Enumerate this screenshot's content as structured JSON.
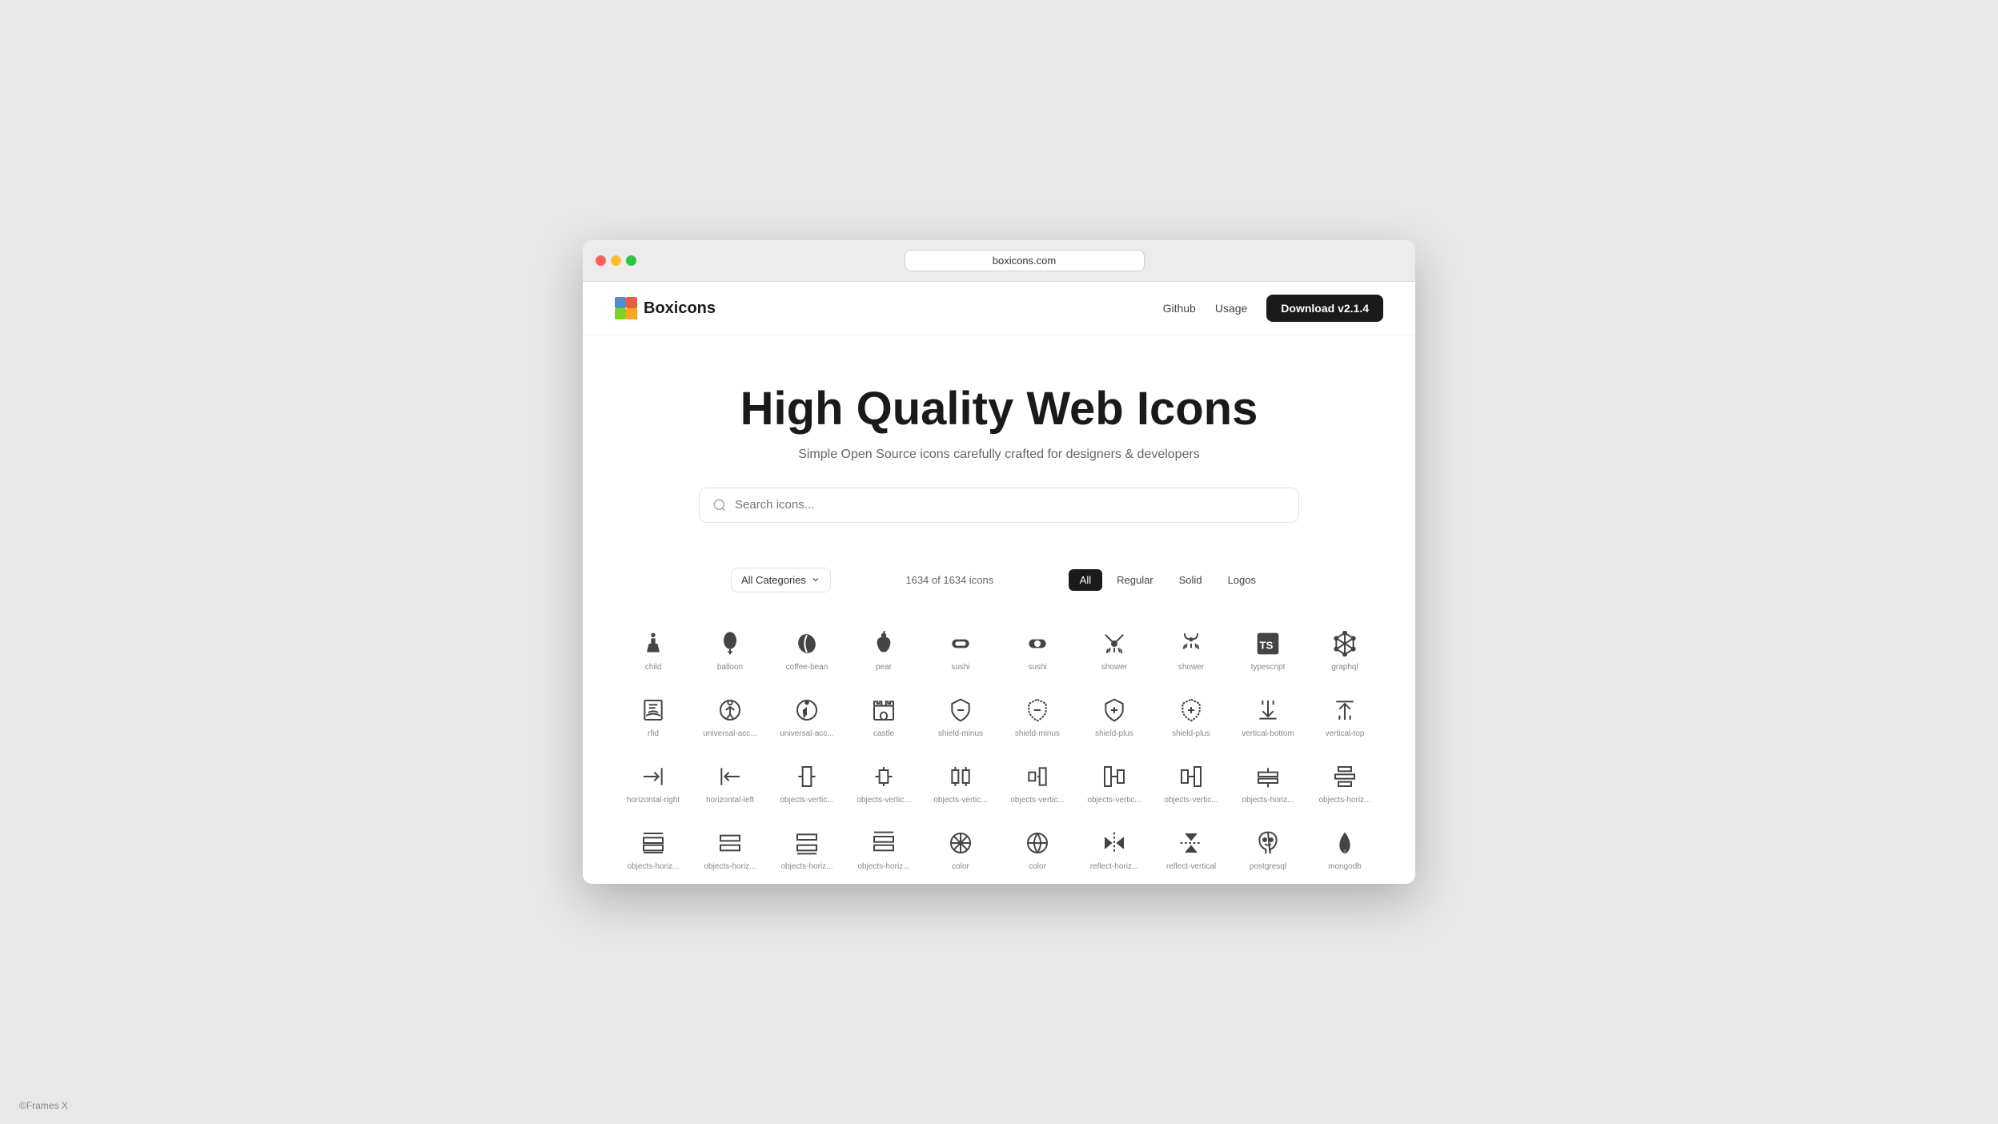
{
  "browser": {
    "url": "boxicons.com"
  },
  "navbar": {
    "logo_text": "Boxicons",
    "github_label": "Github",
    "usage_label": "Usage",
    "download_label": "Download v2.1.4"
  },
  "hero": {
    "title": "High Quality Web Icons",
    "subtitle": "Simple Open Source icons carefully crafted for designers & developers",
    "search_placeholder": "Search icons..."
  },
  "filter_bar": {
    "category_label": "All Categories",
    "icon_count": "1634 of 1634 icons",
    "tabs": [
      "All",
      "Regular",
      "Solid",
      "Logos"
    ]
  },
  "icons_row1": [
    {
      "label": "child",
      "symbol": "🚶"
    },
    {
      "label": "balloon",
      "symbol": "🎈"
    },
    {
      "label": "coffee-bean",
      "symbol": "☕"
    },
    {
      "label": "pear",
      "symbol": "🍐"
    },
    {
      "label": "sushi",
      "symbol": "🍣"
    },
    {
      "label": "sushi",
      "symbol": "🍱"
    },
    {
      "label": "shower",
      "symbol": "🚿"
    },
    {
      "label": "shower",
      "symbol": "🚿"
    },
    {
      "label": "typescript",
      "symbol": "TS"
    },
    {
      "label": "graphql",
      "symbol": "⬡"
    }
  ],
  "icons_row2": [
    {
      "label": "rfid",
      "symbol": "📄"
    },
    {
      "label": "universal-acc...",
      "symbol": "♿"
    },
    {
      "label": "universal-acc...",
      "symbol": "♿"
    },
    {
      "label": "castle",
      "symbol": "🏰"
    },
    {
      "label": "shield-minus",
      "symbol": "🛡"
    },
    {
      "label": "shield-minus",
      "symbol": "🛡"
    },
    {
      "label": "shield-plus",
      "symbol": "🛡"
    },
    {
      "label": "shield-plus",
      "symbol": "🛡"
    },
    {
      "label": "vertical-bottom",
      "symbol": "⬇"
    },
    {
      "label": "vertical-top",
      "symbol": "⬆"
    }
  ],
  "icons_row3": [
    {
      "label": "horizontal-right",
      "symbol": "→"
    },
    {
      "label": "horizontal-left",
      "symbol": "←"
    },
    {
      "label": "objects-vertic...",
      "symbol": "📊"
    },
    {
      "label": "objects-vertic...",
      "symbol": "📊"
    },
    {
      "label": "objects-vertic...",
      "symbol": "📊"
    },
    {
      "label": "objects-vertic...",
      "symbol": "📊"
    },
    {
      "label": "objects-vertic...",
      "symbol": "📊"
    },
    {
      "label": "objects-vertic...",
      "symbol": "📊"
    },
    {
      "label": "objects-horiz...",
      "symbol": "📊"
    },
    {
      "label": "objects-horiz...",
      "symbol": "📊"
    }
  ],
  "icons_row4": [
    {
      "label": "objects-horiz...",
      "symbol": "⊕"
    },
    {
      "label": "objects-horiz...",
      "symbol": "⊞"
    },
    {
      "label": "objects-horiz...",
      "symbol": "⊟"
    },
    {
      "label": "objects-horiz...",
      "symbol": "⊠"
    },
    {
      "label": "color",
      "symbol": "✳"
    },
    {
      "label": "color",
      "symbol": "⊙"
    },
    {
      "label": "reflect-horiz...",
      "symbol": "↔"
    },
    {
      "label": "reflect-vertical",
      "symbol": "↕"
    },
    {
      "label": "postgresql",
      "symbol": "🐘"
    },
    {
      "label": "mongodb",
      "symbol": "🌿"
    }
  ],
  "footer": {
    "credit": "©Frames X"
  }
}
